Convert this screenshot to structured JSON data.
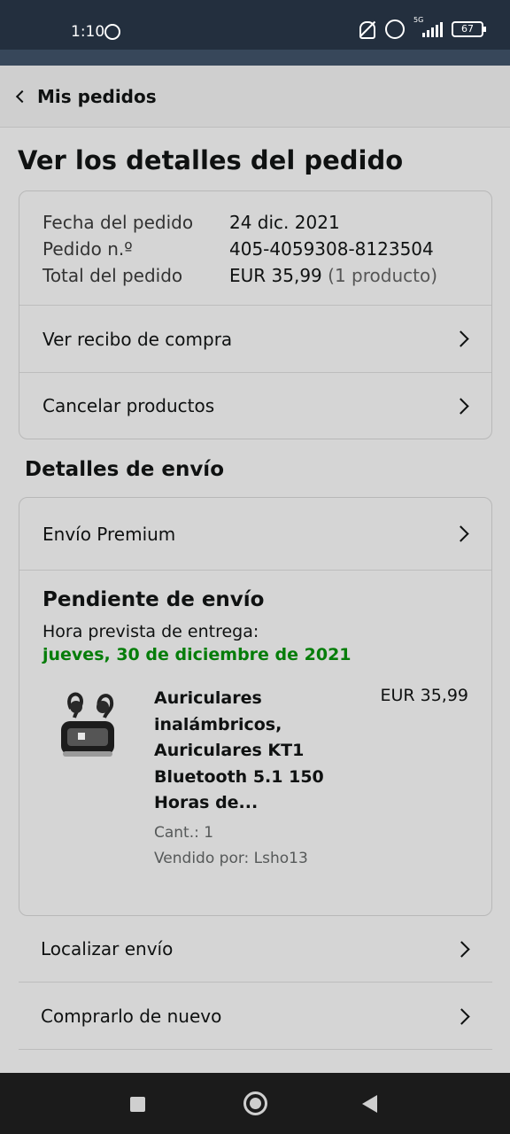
{
  "status_bar": {
    "time": "1:10",
    "network": "5G",
    "battery": "67"
  },
  "header": {
    "back_label": "Mis pedidos"
  },
  "page_title": "Ver los detalles del pedido",
  "order_summary": {
    "date_label": "Fecha del pedido",
    "date_value": "24 dic. 2021",
    "number_label": "Pedido n.º",
    "number_value": "405-4059308-8123504",
    "total_label": "Total del pedido",
    "total_value": "EUR 35,99",
    "total_count": "(1 producto)"
  },
  "order_actions": [
    {
      "label": "Ver recibo de compra"
    },
    {
      "label": "Cancelar productos"
    }
  ],
  "shipping": {
    "section_title": "Detalles de envío",
    "method": "Envío Premium",
    "status": "Pendiente de envío",
    "eta_label": "Hora prevista de entrega:",
    "eta_date": "jueves, 30 de diciembre de 2021"
  },
  "product": {
    "name": "Auriculares inalámbricos, Auriculares KT1 Bluetooth 5.1 150 Horas de...",
    "price": "EUR 35,99",
    "quantity": "Cant.: 1",
    "seller": "Vendido por: Lsho13"
  },
  "more_actions": [
    {
      "label": "Localizar envío"
    },
    {
      "label": "Comprarlo de nuevo"
    }
  ],
  "colors": {
    "delivery_green": "#067d0a",
    "status_bar": "#232f3e"
  }
}
